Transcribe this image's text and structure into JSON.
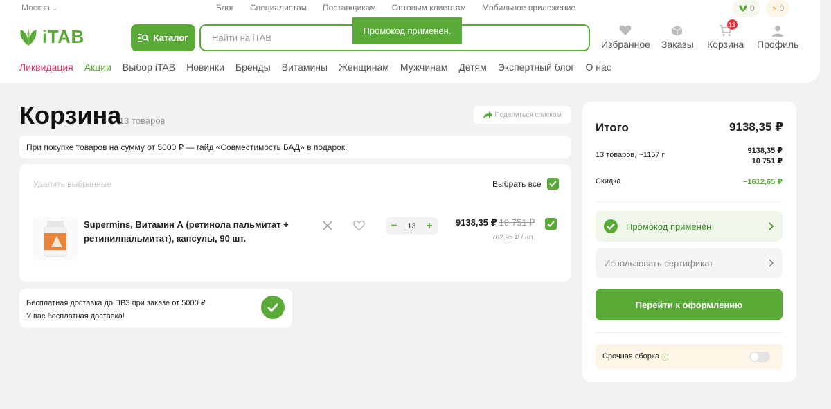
{
  "header": {
    "city": "Москва",
    "top_links": [
      "Блог",
      "Специалистам",
      "Поставщикам",
      "Оптовым клиентам",
      "Мобильное приложение"
    ],
    "bonus_green": "0",
    "bonus_yellow": "0",
    "logo_text": "iTAB",
    "catalog_label": "Каталог",
    "search_placeholder": "Найти на iTAB",
    "icons": {
      "favorites": "Избранное",
      "orders": "Заказы",
      "cart": "Корзина",
      "cart_badge": "13",
      "profile": "Профиль"
    },
    "nav": [
      "Ликвидация",
      "Акции",
      "Выбор iTAB",
      "Новинки",
      "Бренды",
      "Витамины",
      "Женщинам",
      "Мужчинам",
      "Детям",
      "Экспертный блог",
      "О нас"
    ]
  },
  "toast": "Промокод применён.",
  "cart": {
    "title": "Корзина",
    "count": "13 товаров",
    "share_label": "Поделиться списком",
    "promo_note": "При покупке товаров на сумму от 5000 ₽ — гайд «Совместимость БАД» в подарок.",
    "delete_selected": "Удалить выбранные",
    "select_all": "Выбрать все",
    "item": {
      "name": "Supermins, Витамин А (ретинола пальмитат + ретинилпальмитат), капсулы, 90 шт.",
      "quantity": "13",
      "price": "9138,35 ₽",
      "old_price": "10 751 ₽",
      "unit_price": "702,95 ₽ / шт."
    },
    "delivery_line1": "Бесплатная доставка до ПВЗ при заказе от 5000 ₽",
    "delivery_line2": "У вас бесплатная доставка!"
  },
  "summary": {
    "title": "Итого",
    "total": "9138,35 ₽",
    "goods_label": "13 товаров, ~1157 г",
    "goods_price": "9138,35 ₽",
    "goods_old_price": "10 751 ₽",
    "discount_label": "Скидка",
    "discount": "−1612,65 ₽",
    "promo_applied": "Промокод применён",
    "certificate": "Использовать сертификат",
    "checkout": "Перейти к оформлению",
    "urgent": "Срочная сборка"
  },
  "colors": {
    "brand_green": "#5aaa38",
    "accent_red": "#e6305c",
    "badge_red": "#e63946"
  }
}
